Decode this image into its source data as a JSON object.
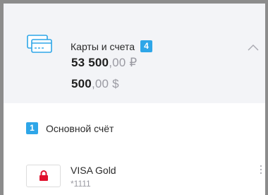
{
  "summary": {
    "title": "Карты и счета",
    "count": "4",
    "balances": [
      {
        "integer": "53 500",
        "decimal": ",00 ₽"
      },
      {
        "integer": "500",
        "decimal": ",00 $"
      }
    ]
  },
  "group": {
    "index": "1",
    "label": "Основной счёт"
  },
  "account": {
    "name": "VISA Gold",
    "number": "*1111"
  },
  "icons": {
    "cards": "cards-icon",
    "chevron": "chevron-up-icon",
    "lock": "lock-icon",
    "more": "more-vertical-icon"
  },
  "colors": {
    "accent": "#2ea6e8",
    "card_icon": "#2ea6e8",
    "lock": "#e0102c",
    "summary_bg": "#f3f4f7",
    "muted": "#9a9aa2"
  }
}
